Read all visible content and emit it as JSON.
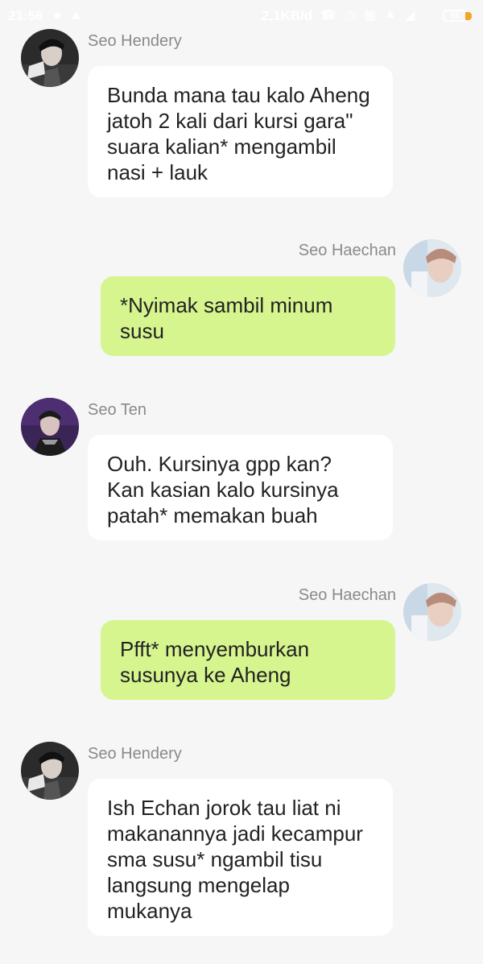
{
  "status_bar": {
    "time": "21:56",
    "network_speed": "2,1KB/d",
    "battery_level": "51",
    "icons": [
      "messenger-icon",
      "warning-icon",
      "call-icon",
      "alarm-icon",
      "sim-icon",
      "signal-icon",
      "wifi-icon"
    ]
  },
  "messages": [
    {
      "sender": "Seo Hendery",
      "side": "left",
      "text": "Bunda mana tau kalo Aheng jatoh 2 kali dari kursi gara\" suara kalian* mengambil nasi + lauk"
    },
    {
      "sender": "Seo Haechan",
      "side": "right",
      "text": "*Nyimak sambil minum susu"
    },
    {
      "sender": "Seo Ten",
      "side": "left",
      "text": "Ouh. Kursinya gpp kan? Kan kasian kalo kursinya patah* memakan buah"
    },
    {
      "sender": "Seo Haechan",
      "side": "right",
      "text": "Pfft* menyemburkan susunya ke Aheng"
    },
    {
      "sender": "Seo Hendery",
      "side": "left",
      "text": "Ish Echan jorok tau liat ni makanannya jadi kecampur sma susu* ngambil tisu langsung mengelap mukanya"
    }
  ],
  "colors": {
    "background": "#f6f6f6",
    "bubble_left": "#ffffff",
    "bubble_right": "#d6f58f",
    "sender_name": "#8a8a8a"
  }
}
